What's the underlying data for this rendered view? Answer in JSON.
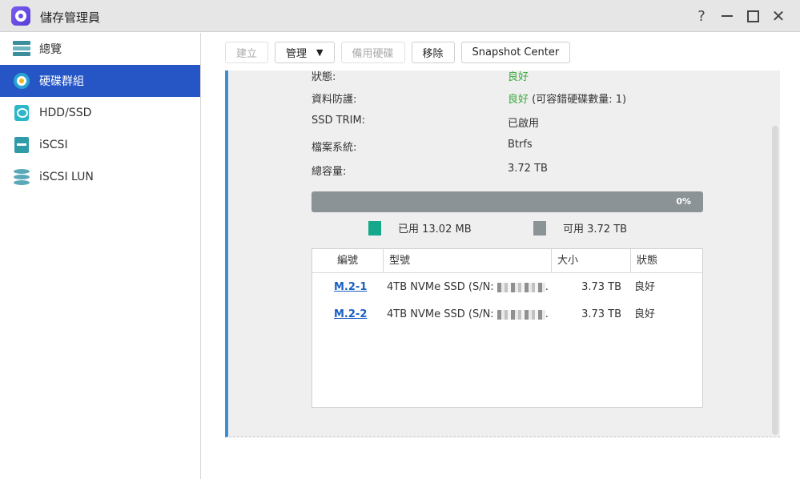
{
  "window": {
    "title": "儲存管理員",
    "icon": "storage-manager-icon",
    "controls": {
      "help": "?",
      "close": "✕"
    }
  },
  "sidebar": {
    "items": [
      {
        "label": "總覽",
        "icon": "overview-icon",
        "active": false
      },
      {
        "label": "硬碟群組",
        "icon": "storage-pool-icon",
        "active": true
      },
      {
        "label": "HDD/SSD",
        "icon": "hdd-ssd-icon",
        "active": false
      },
      {
        "label": "iSCSI",
        "icon": "iscsi-icon",
        "active": false
      },
      {
        "label": "iSCSI LUN",
        "icon": "iscsi-lun-icon",
        "active": false
      }
    ]
  },
  "toolbar": {
    "create": "建立",
    "manage": "管理",
    "hot_spare": "備用硬碟",
    "remove": "移除",
    "snapshot_center": "Snapshot Center"
  },
  "details": {
    "status_label": "狀態:",
    "status_value": "良好",
    "protection_label": "資料防護:",
    "protection_value": "良好",
    "protection_note": " (可容錯硬碟數量: 1)",
    "trim_label": "SSD TRIM:",
    "trim_value": "已啟用",
    "fs_label": "檔案系統:",
    "fs_value": "Btrfs",
    "capacity_label": "總容量:",
    "capacity_value": "3.72 TB"
  },
  "usage": {
    "percent_text": "0%",
    "used_fraction": 0.0,
    "used_label": "已用 13.02 MB",
    "free_label": "可用 3.72 TB",
    "used_color": "#16a88a",
    "free_color": "#8c9396"
  },
  "disk_table": {
    "headers": {
      "id": "編號",
      "model": "型號",
      "size": "大小",
      "status": "狀態"
    },
    "rows": [
      {
        "id": "M.2-1",
        "model": "4TB NVMe SSD (S/N:",
        "suffix": ".",
        "size": "3.73 TB",
        "status": "良好"
      },
      {
        "id": "M.2-2",
        "model": "4TB NVMe SSD (S/N:",
        "suffix": ".",
        "size": "3.73 TB",
        "status": "良好"
      }
    ]
  }
}
